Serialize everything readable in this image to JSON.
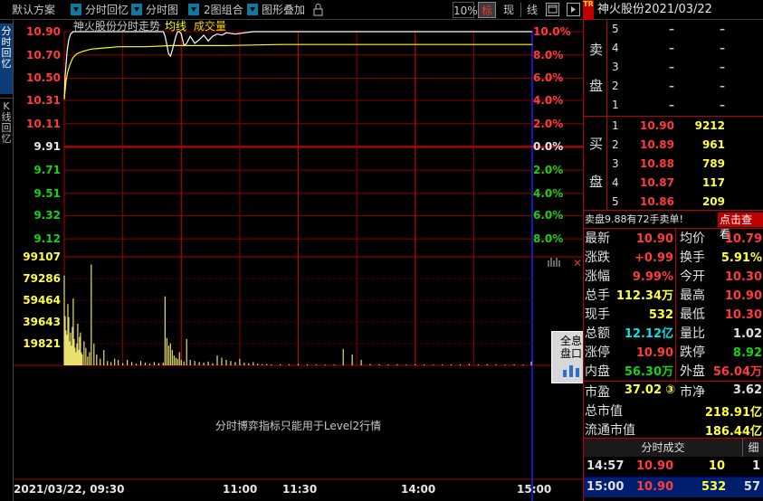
{
  "toolbar": {
    "scheme": "默认方案",
    "replay": "分时回忆",
    "chart": "分时图",
    "combo": "2图组合",
    "overlay": "图形叠加",
    "pct": "10%",
    "btn_biao": "标",
    "btn_xian": "现",
    "btn_line": "线"
  },
  "header": {
    "tr_badge": "TR",
    "title": "神火股份2021/03/22"
  },
  "sidetabs": {
    "timeshare": "分时回忆",
    "kline": "K线回忆"
  },
  "chart_titles": {
    "stock": "神火股份分时走势",
    "avg": "均线",
    "vol": "成交量"
  },
  "chart_data": {
    "type": "line",
    "date": "2021/03/22",
    "prev_close": 9.91,
    "price_axis": {
      "left_ticks": [
        "10.90",
        "10.70",
        "10.50",
        "10.31",
        "10.11",
        "9.91",
        "9.71",
        "9.51",
        "9.32",
        "9.12"
      ],
      "right_ticks": [
        "10.0%",
        "8.0%",
        "6.0%",
        "4.0%",
        "2.0%",
        "0.0%",
        "2.0%",
        "4.0%",
        "6.0%",
        "8.0%"
      ],
      "ylim": [
        9.02,
        10.9
      ]
    },
    "volume_axis": {
      "ticks": [
        "99107",
        "79286",
        "59464",
        "39643",
        "19821"
      ],
      "ylim": [
        0,
        99107
      ]
    },
    "x_ticks": [
      "2021/03/22, 09:30",
      "11:00",
      "11:30",
      "14:00",
      "15:00"
    ],
    "series": [
      {
        "name": "神火股份分时走势",
        "color": "#ffffff",
        "minutes": [
          0,
          1,
          2,
          3,
          4,
          5,
          7,
          10,
          15,
          20,
          25,
          30,
          40,
          50,
          60,
          70,
          80,
          90,
          100,
          110,
          112,
          114,
          116,
          118,
          120,
          122,
          124,
          126,
          128,
          130,
          133,
          136,
          140,
          145,
          150,
          155,
          160,
          165,
          170,
          175,
          180,
          190,
          200,
          210,
          220,
          230,
          240,
          250,
          260,
          270,
          280,
          290,
          300,
          310,
          320,
          330,
          340,
          350,
          360,
          370,
          380,
          390,
          400,
          410,
          420,
          430,
          440,
          450,
          460,
          470,
          480,
          490,
          500,
          510,
          520
        ],
        "prices": [
          10.32,
          10.52,
          10.62,
          10.72,
          10.78,
          10.83,
          10.88,
          10.9,
          10.9,
          10.9,
          10.9,
          10.9,
          10.9,
          10.9,
          10.9,
          10.9,
          10.9,
          10.9,
          10.9,
          10.9,
          10.86,
          10.79,
          10.71,
          10.69,
          10.74,
          10.8,
          10.86,
          10.9,
          10.9,
          10.88,
          10.78,
          10.8,
          10.86,
          10.8,
          10.83,
          10.87,
          10.82,
          10.86,
          10.88,
          10.87,
          10.89,
          10.88,
          10.89,
          10.9,
          10.9,
          10.9,
          10.9,
          10.9,
          10.9,
          10.9,
          10.9,
          10.9,
          10.9,
          10.9,
          10.9,
          10.9,
          10.9,
          10.9,
          10.9,
          10.9,
          10.9,
          10.9,
          10.9,
          10.9,
          10.9,
          10.9,
          10.9,
          10.9,
          10.9,
          10.9,
          10.9,
          10.9,
          10.9,
          10.9,
          10.9
        ]
      },
      {
        "name": "均线",
        "color": "#ffff00",
        "minutes": [
          0,
          2,
          4,
          6,
          8,
          10,
          14,
          20,
          30,
          45,
          60,
          90,
          120,
          180,
          240,
          300,
          360,
          420,
          480,
          520
        ],
        "prices": [
          10.32,
          10.48,
          10.56,
          10.61,
          10.65,
          10.68,
          10.71,
          10.73,
          10.75,
          10.76,
          10.77,
          10.77,
          10.78,
          10.78,
          10.79,
          10.79,
          10.79,
          10.79,
          10.79,
          10.79
        ]
      }
    ],
    "volume_bars": {
      "minutes": [
        0,
        1,
        2,
        3,
        4,
        5,
        6,
        7,
        8,
        9,
        10,
        11,
        12,
        13,
        14,
        15,
        16,
        17,
        18,
        19,
        20,
        22,
        24,
        26,
        28,
        30,
        33,
        36,
        40,
        44,
        48,
        52,
        56,
        60,
        65,
        70,
        75,
        80,
        85,
        90,
        95,
        100,
        105,
        110,
        112,
        114,
        116,
        118,
        120,
        122,
        124,
        126,
        128,
        130,
        133,
        136,
        140,
        145,
        150,
        155,
        160,
        165,
        170,
        175,
        180,
        185,
        190,
        195,
        200,
        205,
        210,
        215,
        220,
        225,
        230,
        240,
        250,
        260,
        270,
        280,
        290,
        300,
        310,
        320,
        330,
        340,
        350,
        360,
        370,
        380,
        390,
        400,
        410,
        420,
        430,
        440,
        450,
        460,
        470,
        480,
        490,
        500,
        510,
        519
      ],
      "values": [
        82000,
        45000,
        32000,
        28000,
        56000,
        44000,
        22000,
        30000,
        18000,
        35000,
        61000,
        24000,
        16000,
        12000,
        20000,
        38000,
        14000,
        26000,
        30000,
        12000,
        10000,
        22000,
        16000,
        8000,
        12000,
        92000,
        20000,
        10000,
        6000,
        14000,
        4000,
        3000,
        6000,
        5000,
        2000,
        5000,
        3000,
        1500,
        4000,
        2500,
        1500,
        3000,
        2000,
        2500,
        63000,
        25000,
        18000,
        20000,
        14000,
        9000,
        7000,
        6000,
        12000,
        5000,
        3500,
        24000,
        5000,
        4000,
        3000,
        2500,
        3500,
        2000,
        9000,
        7000,
        5000,
        4000,
        3000,
        6000,
        2500,
        2000,
        3000,
        1500,
        1000,
        1200,
        800,
        1000,
        900,
        1200,
        800,
        700,
        600,
        700,
        15000,
        10000,
        5000,
        1200,
        1000,
        800,
        1000,
        600,
        900,
        800,
        600,
        700,
        800,
        900,
        1200,
        800,
        1000,
        700,
        600,
        900,
        700,
        3500
      ]
    }
  },
  "level2_msg": "分时博弈指标只能用于Level2行情",
  "full_btn": {
    "line1": "全息",
    "line2": "盘口"
  },
  "order_book": {
    "sell_label_1": "卖",
    "sell_label_2": "盘",
    "buy_label_1": "买",
    "buy_label_2": "盘",
    "asks": [
      {
        "level": "5",
        "price": "–",
        "vol": "–"
      },
      {
        "level": "4",
        "price": "–",
        "vol": "–"
      },
      {
        "level": "3",
        "price": "–",
        "vol": "–"
      },
      {
        "level": "2",
        "price": "–",
        "vol": "–"
      },
      {
        "level": "1",
        "price": "–",
        "vol": "–"
      }
    ],
    "bids": [
      {
        "level": "1",
        "price": "10.90",
        "vol": "9212"
      },
      {
        "level": "2",
        "price": "10.89",
        "vol": "961"
      },
      {
        "level": "3",
        "price": "10.88",
        "vol": "789"
      },
      {
        "level": "4",
        "price": "10.87",
        "vol": "117"
      },
      {
        "level": "5",
        "price": "10.86",
        "vol": "209"
      }
    ]
  },
  "sell_notice": {
    "text": "卖盘9.88有72手卖单!",
    "button": "点击查看"
  },
  "quote": {
    "rows": [
      {
        "l1": "最新",
        "v1": "10.90",
        "c1": "#ff3b3b",
        "l2": "均价",
        "v2": "10.79",
        "c2": "#ff3b3b"
      },
      {
        "l1": "涨跌",
        "v1": "+0.99",
        "c1": "#ff3b3b",
        "l2": "换手",
        "v2": "5.91%",
        "c2": "#ffff40"
      },
      {
        "l1": "涨幅",
        "v1": "9.99%",
        "c1": "#ff3b3b",
        "l2": "今开",
        "v2": "10.30",
        "c2": "#ff3b3b"
      },
      {
        "l1": "总手",
        "v1": "112.34万",
        "c1": "#ffff40",
        "l2": "最高",
        "v2": "10.90",
        "c2": "#ff3b3b"
      },
      {
        "l1": "现手",
        "v1": "532",
        "c1": "#ffff40",
        "l2": "最低",
        "v2": "10.30",
        "c2": "#ff3b3b"
      },
      {
        "l1": "总额",
        "v1": "12.12亿",
        "c1": "#00e5e5",
        "l2": "量比",
        "v2": "1.02",
        "c2": "#e0e0e0"
      },
      {
        "l1": "涨停",
        "v1": "10.90",
        "c1": "#ff3b3b",
        "l2": "跌停",
        "v2": "8.92",
        "c2": "#14d214"
      },
      {
        "l1": "内盘",
        "v1": "56.30万",
        "c1": "#14d214",
        "l2": "外盘",
        "v2": "56.04万",
        "c2": "#ff3b3b"
      }
    ],
    "pe_label": "市盈",
    "pe_value": "37.02",
    "pe_badge": "③",
    "pb_label": "市净",
    "pb_value": "3.62",
    "mcap_label": "总市值",
    "mcap_value": "218.91亿",
    "float_label": "流通市值",
    "float_value": "186.44亿"
  },
  "ticks": {
    "title": "分时成交",
    "detail": "细",
    "rows": [
      {
        "time": "14:57",
        "price": "10.90",
        "vol": "10",
        "num": "1"
      },
      {
        "time": "15:00",
        "price": "10.90",
        "vol": "532",
        "num": "57"
      }
    ]
  }
}
